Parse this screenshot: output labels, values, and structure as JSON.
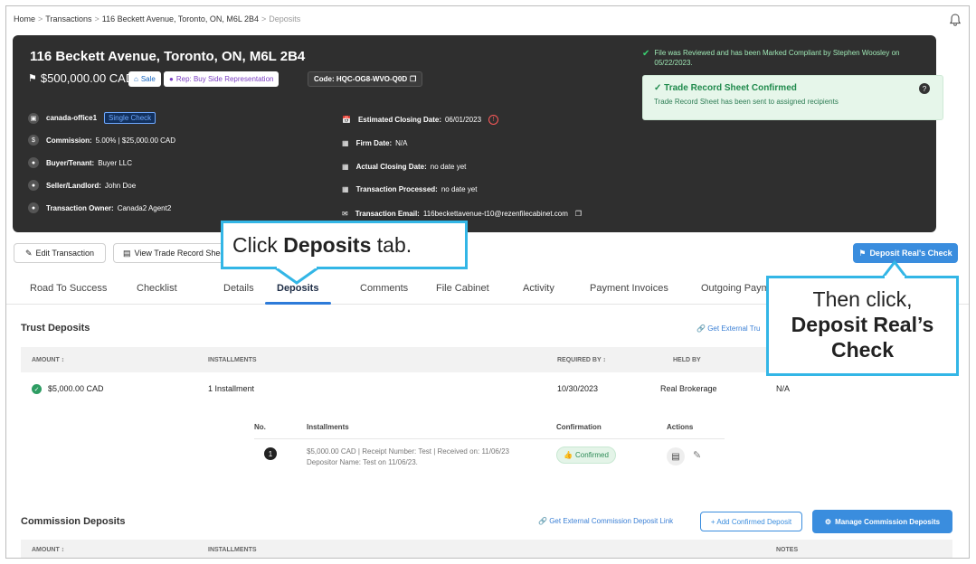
{
  "breadcrumb": {
    "items": [
      "Home",
      "Transactions",
      "116 Beckett Avenue, Toronto, ON, M6L 2B4",
      "Deposits"
    ],
    "separator": ">"
  },
  "header": {
    "title": "116 Beckett Avenue, Toronto, ON, M6L 2B4",
    "price": "$500,000.00 CAD",
    "sale_badge": "Sale",
    "rep_badge": "Rep: Buy Side Representation",
    "code": "Code: HQC-OG8-WVO-Q0D",
    "office": "canada-office1",
    "single_check": "Single Check",
    "commission_label": "Commission:",
    "commission_value": "5.00% | $25,000.00 CAD",
    "buyer_label": "Buyer/Tenant:",
    "buyer_value": "Buyer LLC",
    "seller_label": "Seller/Landlord:",
    "seller_value": "John Doe",
    "owner_label": "Transaction Owner:",
    "owner_value": "Canada2 Agent2",
    "est_closing_label": "Estimated Closing Date:",
    "est_closing_value": "06/01/2023",
    "firm_label": "Firm Date:",
    "firm_value": "N/A",
    "actual_closing_label": "Actual Closing Date:",
    "actual_closing_value": "no date yet",
    "processed_label": "Transaction Processed:",
    "processed_value": "no date yet",
    "email_label": "Transaction Email:",
    "email_value": "116beckettavenue-t10@rezenfilecabinet.com",
    "compliance_text": "File was Reviewed and has been Marked Compliant by Stephen Woosley on 05/22/2023.",
    "trade_title": "Trade Record Sheet Confirmed",
    "trade_sub": "Trade Record Sheet has been sent to assigned recipients"
  },
  "actions": {
    "edit": "Edit Transaction",
    "view_trade": "View Trade Record Sheet",
    "deposit_check": "Deposit Real's Check"
  },
  "tabs": [
    "Road To Success",
    "Checklist",
    "Details",
    "Deposits",
    "Comments",
    "File Cabinet",
    "Activity",
    "Payment Invoices",
    "Outgoing Paym"
  ],
  "trust": {
    "title": "Trust Deposits",
    "external_link": "Get External Tru",
    "headers": {
      "amount": "AMOUNT ↕",
      "installments": "INSTALLMENTS",
      "required_by": "REQUIRED BY ↕",
      "held_by": "HELD BY"
    },
    "row": {
      "amount": "$5,000.00 CAD",
      "installments": "1 Installment",
      "required_by": "10/30/2023",
      "held_by": "Real Brokerage",
      "notes": "N/A"
    },
    "sub_headers": {
      "no": "No.",
      "installments": "Installments",
      "confirmation": "Confirmation",
      "actions": "Actions"
    },
    "sub_row": {
      "no": "1",
      "line1": "$5,000.00 CAD | Receipt Number: Test | Received on: 11/06/23",
      "line2": "Depositor Name: Test on 11/06/23.",
      "confirmation": "Confirmed"
    }
  },
  "commission": {
    "title": "Commission Deposits",
    "external_link": "Get External Commission Deposit Link",
    "add_button": "+ Add Confirmed Deposit",
    "manage_button": "Manage Commission Deposits",
    "headers": {
      "amount": "AMOUNT ↕",
      "installments": "INSTALLMENTS",
      "notes": "NOTES"
    }
  },
  "callouts": {
    "tab_pre": "Click ",
    "tab_bold": "Deposits",
    "tab_post": " tab.",
    "check_pre": "Then click,",
    "check_bold1": "Deposit Real’s",
    "check_bold2": "Check"
  },
  "colors": {
    "accent": "#3a8dde",
    "callout_border": "#33b6e6",
    "hero_bg": "#2f2f2f",
    "success": "#2e8b57"
  }
}
